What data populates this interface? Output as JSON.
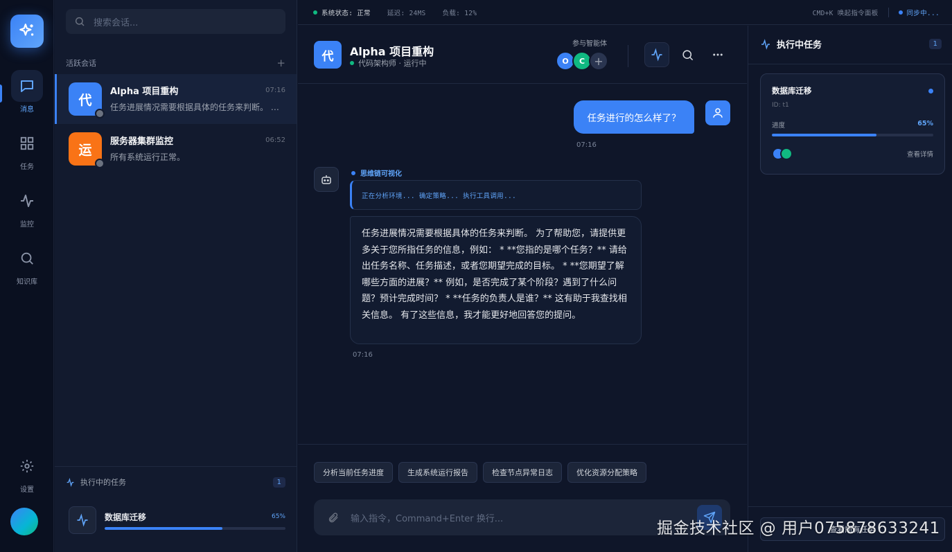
{
  "colors": {
    "accent": "#3b82f6",
    "success": "#10b981",
    "warning": "#f97316",
    "bg": "#0f1629"
  },
  "nav": {
    "items": [
      {
        "label": "消息",
        "icon": "message-icon"
      },
      {
        "label": "任务",
        "icon": "grid-icon"
      },
      {
        "label": "监控",
        "icon": "activity-icon"
      },
      {
        "label": "知识库",
        "icon": "search-icon"
      }
    ],
    "settings_label": "设置"
  },
  "sidebar": {
    "search_placeholder": "搜索会话...",
    "section_title": "活跃会话",
    "add_symbol": "+",
    "conversations": [
      {
        "avatar": "代",
        "title": "Alpha 项目重构",
        "time": "07:16",
        "preview": "任务进展情况需要根据具体的任务来判断。 为了帮助您，请提供更多关于您所指任务的信息"
      },
      {
        "avatar": "运",
        "title": "服务器集群监控",
        "time": "06:52",
        "preview": "所有系统运行正常。"
      }
    ],
    "running": {
      "title": "执行中的任务",
      "count": "1",
      "task_name": "数据库迁移",
      "percent_label": "65%",
      "progress": 0.65
    }
  },
  "statusbar": {
    "system": "系统状态: 正常",
    "latency": "延迟: 24MS",
    "load": "负载: 12%",
    "shortcut": "CMD+K 唤起指令面板",
    "sync": "同步中..."
  },
  "chat": {
    "avatar": "代",
    "title": "Alpha 项目重构",
    "subtitle": "代码架构师 · 运行中",
    "agents_label": "参与智能体",
    "agents": [
      "O",
      "C"
    ],
    "add_agent": "+",
    "messages": {
      "user_text": "任务进行的怎么样了？",
      "user_time": "07:16",
      "think_label": "思维链可视化",
      "think_text": "正在分析环境... 确定策略... 执行工具调用...",
      "bot_text": "任务进展情况需要根据具体的任务来判断。 为了帮助您，请提供更多关于您所指任务的信息，例如： * **您指的是哪个任务？** 请给出任务名称、任务描述，或者您期望完成的目标。 * **您期望了解哪些方面的进展？** 例如，是否完成了某个阶段？遇到了什么问题？预计完成时间？ * **任务的负责人是谁？** 这有助于我查找相关信息。 有了这些信息，我才能更好地回答您的提问。",
      "bot_time": "07:16"
    },
    "quick_actions": [
      "分析当前任务进度",
      "生成系统运行报告",
      "检查节点异常日志",
      "优化资源分配策略"
    ],
    "input_placeholder": "输入指令，Command+Enter 换行..."
  },
  "right_panel": {
    "title": "执行中任务",
    "count": "1",
    "task": {
      "name": "数据库迁移",
      "id": "ID: t1",
      "progress_label": "进度",
      "percent_label": "65%",
      "progress": 0.65,
      "link": "查看详情"
    },
    "bottom_button": "查看所有任务"
  },
  "watermark": "掘金技术社区 @ 用户075878633241"
}
